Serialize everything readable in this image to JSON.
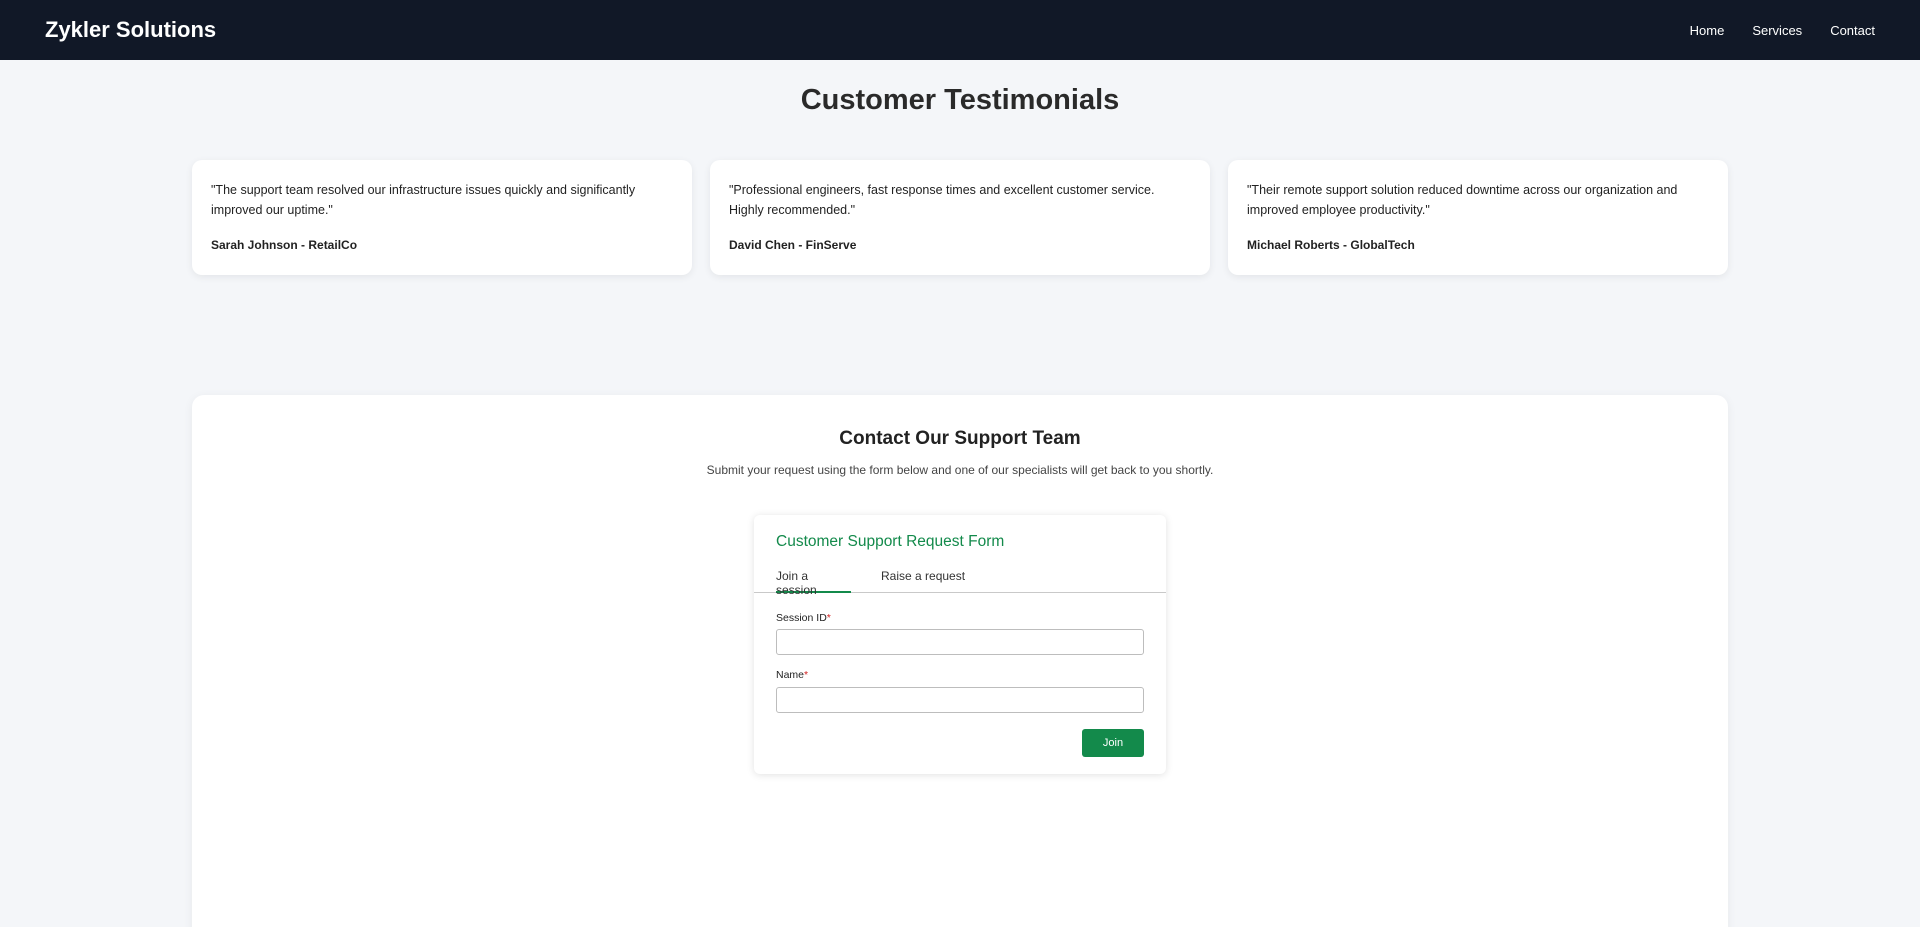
{
  "navbar": {
    "brand": "Zykler Solutions",
    "links": [
      "Home",
      "Services",
      "Contact"
    ]
  },
  "testimonials": {
    "title": "Customer Testimonials",
    "items": [
      {
        "quote": "\"The support team resolved our infrastructure issues quickly and significantly improved our uptime.\"",
        "author": "Sarah Johnson - RetailCo"
      },
      {
        "quote": "\"Professional engineers, fast response times and excellent customer service. Highly recommended.\"",
        "author": "David Chen - FinServe"
      },
      {
        "quote": "\"Their remote support solution reduced downtime across our organization and improved employee productivity.\"",
        "author": "Michael Roberts - GlobalTech"
      }
    ]
  },
  "contact": {
    "title": "Contact Our Support Team",
    "subtitle": "Submit your request using the form below and one of our specialists will get back to you shortly."
  },
  "form": {
    "title": "Customer Support Request Form",
    "tabs": [
      "Join a session",
      "Raise a request"
    ],
    "session_label": "Session ID",
    "session_value": "",
    "name_label": "Name",
    "name_value": "",
    "required_mark": "*",
    "join_label": "Join"
  },
  "colors": {
    "navbar_bg": "#111827",
    "accent_green": "#138a4b",
    "required_red": "#d21f1f",
    "page_bg": "#f4f6f9"
  }
}
